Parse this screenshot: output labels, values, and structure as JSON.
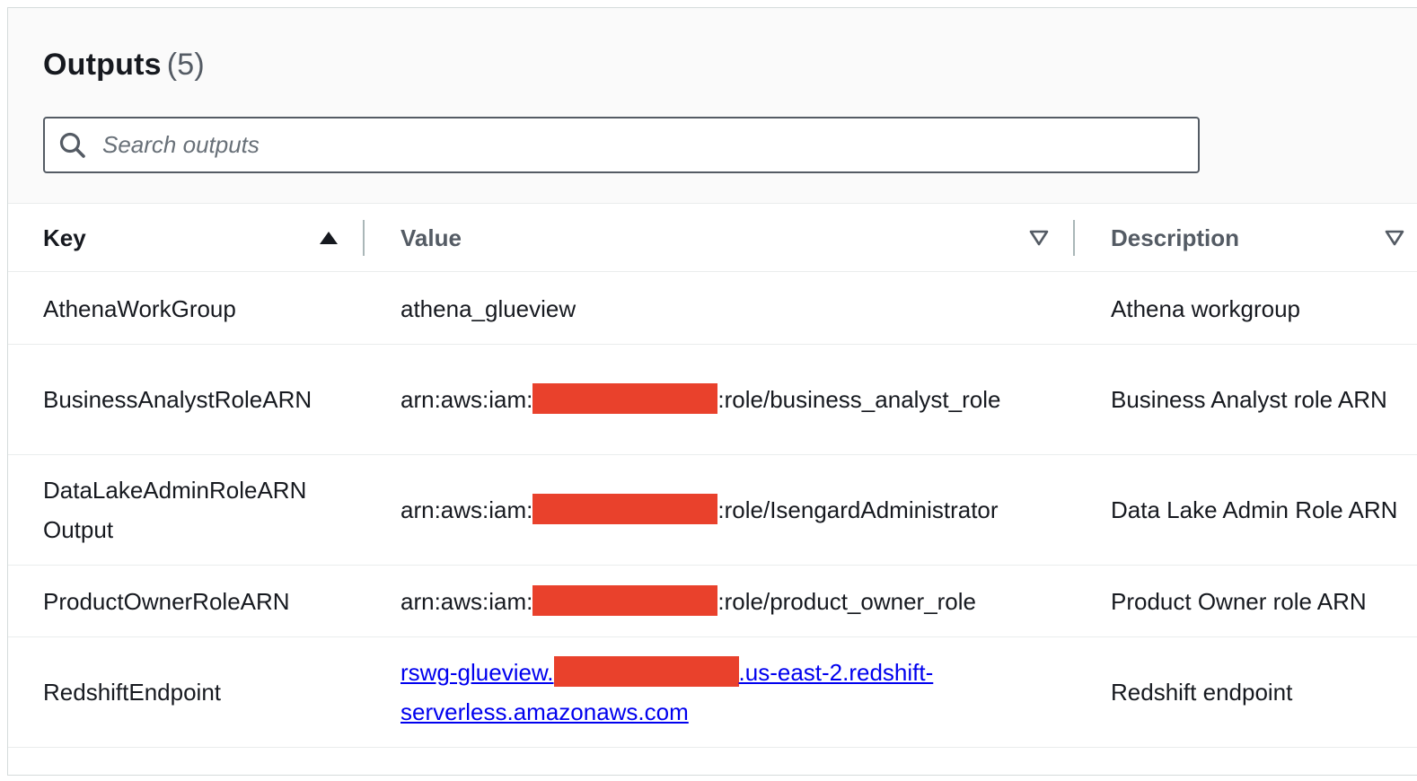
{
  "header": {
    "title": "Outputs",
    "count": "(5)"
  },
  "search": {
    "placeholder": "Search outputs"
  },
  "table": {
    "columns": {
      "key": "Key",
      "value": "Value",
      "description": "Description"
    },
    "rows": [
      {
        "key": "AthenaWorkGroup",
        "value_prefix": "athena_glueview",
        "value_suffix": "",
        "description": "Athena workgroup"
      },
      {
        "key": "BusinessAnalystRoleARN",
        "value_prefix": "arn:aws:iam:",
        "value_suffix": ":role/business_analyst_role",
        "description": "Business Analyst role ARN"
      },
      {
        "key": "DataLakeAdminRoleARN Output",
        "value_prefix": "arn:aws:iam:",
        "value_suffix": ":role/IsengardAdministrator",
        "description": "Data Lake Admin Role ARN"
      },
      {
        "key": "ProductOwnerRoleARN",
        "value_prefix": "arn:aws:iam:",
        "value_suffix": ":role/product_owner_role",
        "description": "Product Owner role ARN"
      },
      {
        "key": "RedshiftEndpoint",
        "value_prefix": "rswg-glueview.",
        "value_suffix": ".us-east-2.redshift-serverless.amazonaws.com",
        "description": "Redshift endpoint"
      }
    ]
  },
  "colors": {
    "redaction": "#e9412c",
    "link": "#0000ee",
    "header_bg": "#fafafa"
  }
}
